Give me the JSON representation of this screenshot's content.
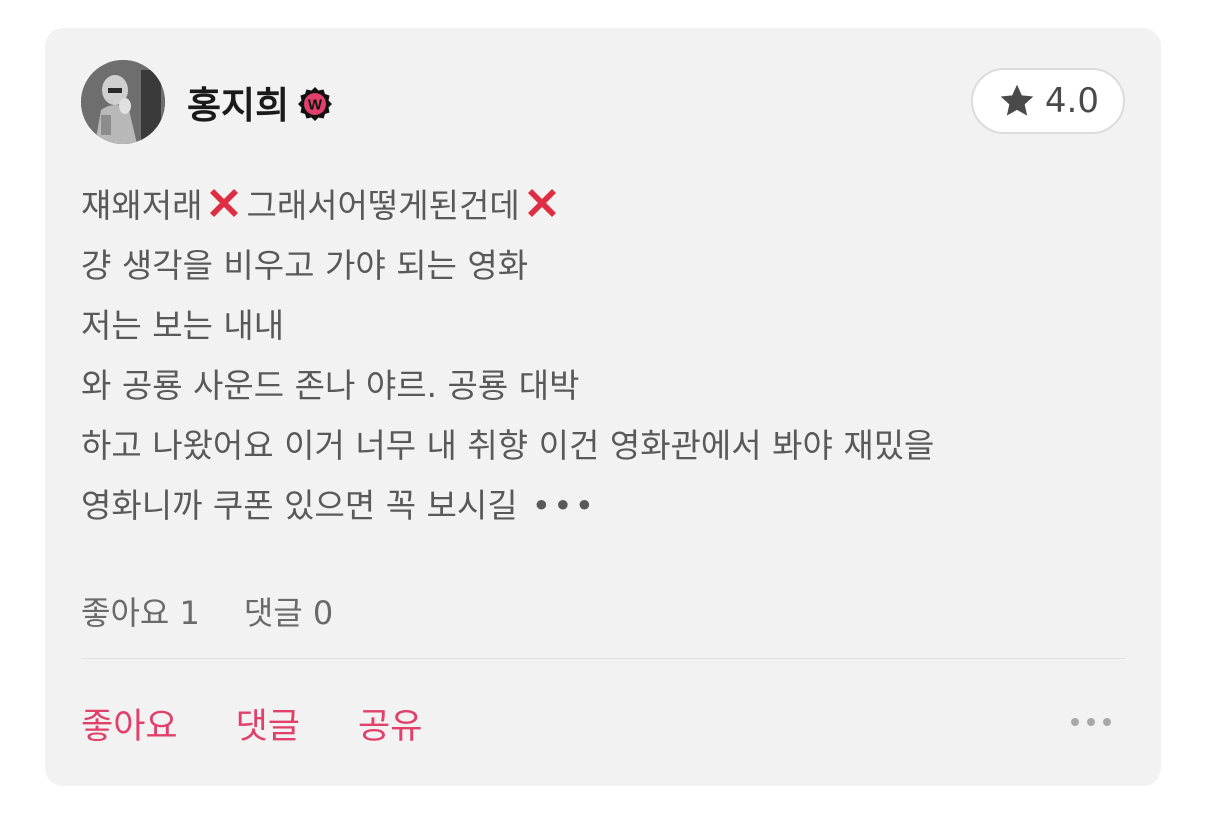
{
  "user": {
    "name": "홍지희",
    "badge_letter": "W",
    "badge_color": "#e0406a"
  },
  "rating": {
    "icon": "star-icon",
    "value": "4.0"
  },
  "review": {
    "line1_a": "쟤왜저래",
    "line1_b": "그래서어떻게된건데",
    "line2": "걍 생각을 비우고 가야 되는 영화",
    "line3": "저는 보는 내내",
    "line4": "와 공룡 사운드 존나 야르. 공룡 대박",
    "line5": "하고 나왔어요 이거 너무 내 취향 이건 영화관에서 봐야 재밌을",
    "line6": "영화니까 쿠폰 있으면 꼭 보시길",
    "more": "•••"
  },
  "stats": {
    "likes": "좋아요 1",
    "comments": "댓글 0"
  },
  "actions": {
    "like": "좋아요",
    "comment": "댓글",
    "share": "공유"
  },
  "colors": {
    "accent": "#e0406a",
    "card_bg": "#f2f2f2",
    "x_mark": "#dd2e44"
  }
}
